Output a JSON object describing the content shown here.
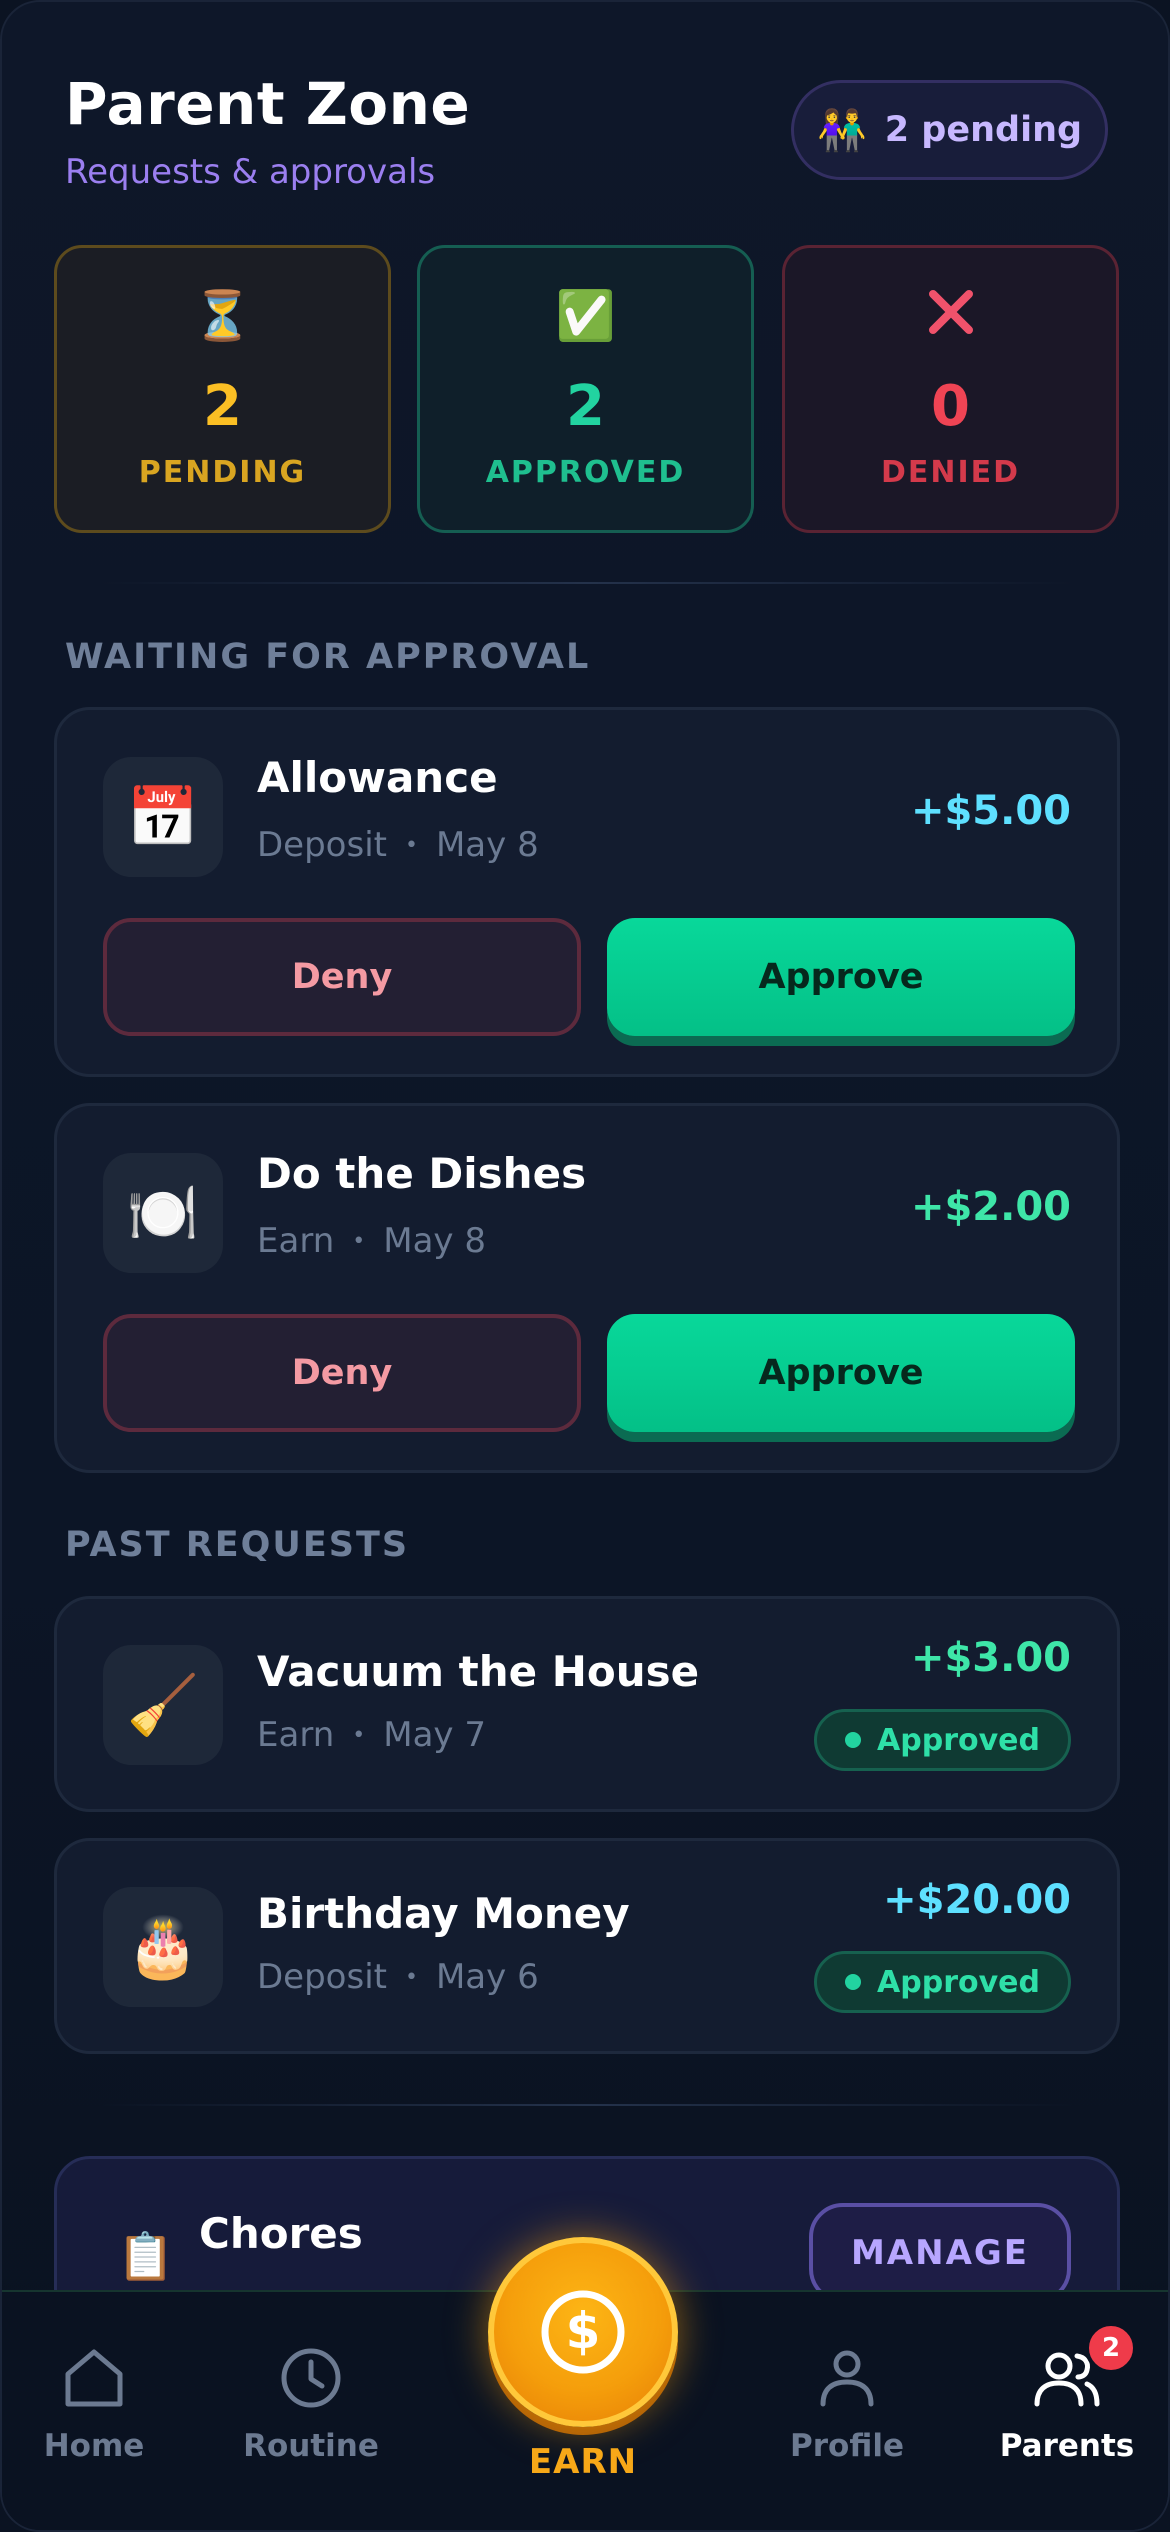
{
  "header": {
    "title": "Parent Zone",
    "subtitle": "Requests & approvals",
    "pending_pill": {
      "icon": "family-icon",
      "emoji": "👫",
      "label": "2 pending"
    }
  },
  "stats": [
    {
      "key": "pending",
      "icon": "hourglass-icon",
      "emoji": "⏳",
      "value": "2",
      "label": "PENDING",
      "color": "#fbbf24"
    },
    {
      "key": "approved",
      "icon": "check-icon",
      "emoji": "✅",
      "value": "2",
      "label": "APPROVED",
      "color": "#22d3a0"
    },
    {
      "key": "denied",
      "icon": "cross-icon",
      "emoji": "❌",
      "value": "0",
      "label": "DENIED",
      "color": "#ef4454"
    }
  ],
  "waiting": {
    "heading": "WAITING FOR APPROVAL",
    "items": [
      {
        "icon": "calendar-icon",
        "emoji": "📅",
        "name": "Allowance",
        "type": "Deposit",
        "date": "May 8",
        "amount": "+$5.00",
        "amount_color": "#5ee0ff",
        "deny_label": "Deny",
        "approve_label": "Approve"
      },
      {
        "icon": "plate-icon",
        "emoji": "🍽️",
        "name": "Do the Dishes",
        "type": "Earn",
        "date": "May 8",
        "amount": "+$2.00",
        "amount_color": "#3ee6a8",
        "deny_label": "Deny",
        "approve_label": "Approve"
      }
    ]
  },
  "past": {
    "heading": "PAST REQUESTS",
    "items": [
      {
        "icon": "broom-icon",
        "emoji": "🧹",
        "name": "Vacuum the House",
        "type": "Earn",
        "date": "May 7",
        "amount": "+$3.00",
        "amount_color": "#3ee6a8",
        "status": "Approved"
      },
      {
        "icon": "cake-icon",
        "emoji": "🎂",
        "name": "Birthday Money",
        "type": "Deposit",
        "date": "May 6",
        "amount": "+$20.00",
        "amount_color": "#5ee0ff",
        "status": "Approved"
      }
    ]
  },
  "chores": {
    "icon": "clipboard-icon",
    "emoji": "📋",
    "title": "Chores",
    "button": "MANAGE"
  },
  "nav": {
    "items": [
      {
        "key": "home",
        "label": "Home"
      },
      {
        "key": "routine",
        "label": "Routine"
      },
      {
        "key": "earn",
        "label": "EARN"
      },
      {
        "key": "profile",
        "label": "Profile"
      },
      {
        "key": "parents",
        "label": "Parents",
        "badge": "2",
        "active": true
      }
    ]
  }
}
